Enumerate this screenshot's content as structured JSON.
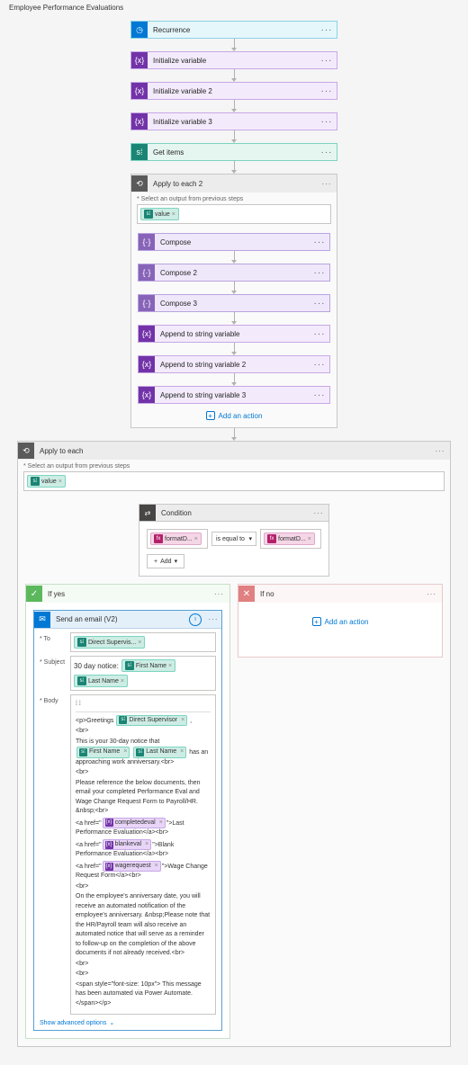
{
  "title": "Employee Performance Evaluations",
  "steps": {
    "recurrence": "Recurrence",
    "init1": "Initialize variable",
    "init2": "Initialize variable 2",
    "init3": "Initialize variable 3",
    "getitems": "Get items",
    "foreach2": "Apply to each 2",
    "selectHint": "* Select an output from previous steps",
    "valueToken": "value",
    "compose1": "Compose",
    "compose2": "Compose 2",
    "compose3": "Compose 3",
    "append1": "Append to string variable",
    "append2": "Append to string variable 2",
    "append3": "Append to string variable 3",
    "addAction": "Add an action",
    "foreach1": "Apply to each",
    "condition": "Condition",
    "condLeft": "formatD...",
    "condOp": "is equal to",
    "condRight": "formatD...",
    "addBtn": "Add",
    "yes": "If yes",
    "no": "If no",
    "email": {
      "title": "Send an email (V2)",
      "to": "* To",
      "toToken": "Direct Supervis...",
      "subject": "* Subject",
      "subjPrefix": "30 day notice:",
      "firstName": "First Name",
      "lastName": "Last Name",
      "body": "* Body",
      "greeting": "<p>Greetings",
      "directSup": "Direct Supervisor",
      "line2a": "This is your 30-day notice that",
      "line2b": "has an approaching work anniversary.<br>",
      "br": "<br>",
      "line3": "Please reference the below documents, then email your completed Performance Eval and Wage Change Request Form to Payroll/HR. &nbsp;<br>",
      "ahref": "<a href=\"",
      "completedeval": "completedeval",
      "doc1": "\">Last Performance Evaluation</a><br>",
      "blankeval": "blankeval",
      "doc2": "\">Blank Performance Evaluation</a><br>",
      "wagerequest": "wagerequest",
      "doc3": "\">Wage Change Request Form</a><br>",
      "line4": "On the employee's anniversary date, you will receive an automated notification of the employee's anniversary. &nbsp;Please note that the HR/Payroll team will also receive an automated notice that will serve as a reminder to follow-up on the completion of the above documents if not already received.<br>",
      "line5": "<span style=\"font-size: 10px\"> This message has been automated via Power Automate.</span></p>",
      "advanced": "Show advanced options"
    }
  }
}
